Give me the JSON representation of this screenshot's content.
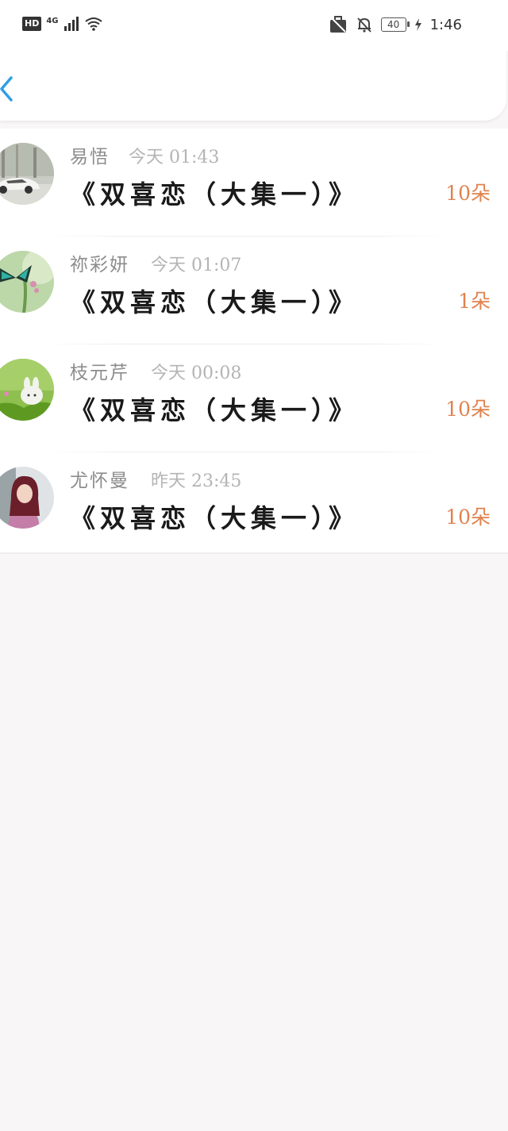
{
  "status_bar": {
    "hd": "HD",
    "network": "4G",
    "battery": "40",
    "time": "1:46"
  },
  "header": {
    "back_icon": "chevron-left-icon",
    "accent": "#2f9fe6"
  },
  "colors": {
    "flowers": "#e0824d",
    "name": "#8d8d8d",
    "time": "#b4b4b4"
  },
  "rows": [
    {
      "name": "易悟",
      "time": "今天 01:43",
      "title": "《双喜恋（大集一）》",
      "flowers": "10朵",
      "avatar": "car-photo"
    },
    {
      "name": "祢彩妍",
      "time": "今天 01:07",
      "title": "《双喜恋（大集一）》",
      "flowers": "1朵",
      "avatar": "butterfly-photo"
    },
    {
      "name": "枝元芹",
      "time": "今天 00:08",
      "title": "《双喜恋（大集一）》",
      "flowers": "10朵",
      "avatar": "bunny-photo"
    },
    {
      "name": "尤怀曼",
      "time": "昨天 23:45",
      "title": "《双喜恋（大集一）》",
      "flowers": "10朵",
      "avatar": "girl-photo"
    }
  ]
}
